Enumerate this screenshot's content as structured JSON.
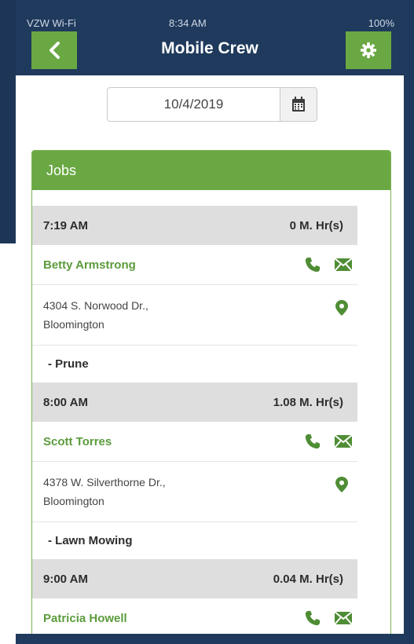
{
  "statusbar": {
    "carrier": "VZW Wi-Fi",
    "time": "8:34 AM",
    "battery": "100%"
  },
  "header": {
    "title": "Mobile Crew",
    "back_icon": "chevron-left-icon",
    "settings_icon": "gear-icon"
  },
  "date_picker": {
    "value": "10/4/2019",
    "icon": "calendar-icon"
  },
  "jobs_panel": {
    "title": "Jobs",
    "jobs": [
      {
        "time": "7:19 AM",
        "hours": "0 M. Hr(s)",
        "name": "Betty Armstrong",
        "address_line1": "4304 S. Norwood Dr.,",
        "address_line2": "Bloomington",
        "task": "- Prune"
      },
      {
        "time": "8:00 AM",
        "hours": "1.08 M. Hr(s)",
        "name": "Scott Torres",
        "address_line1": "4378 W. Silverthorne Dr.,",
        "address_line2": "Bloomington",
        "task": "- Lawn Mowing"
      },
      {
        "time": "9:00 AM",
        "hours": "0.04 M. Hr(s)",
        "name": "Patricia Howell"
      }
    ]
  },
  "colors": {
    "navy": "#1f3a5c",
    "green": "#6aa843",
    "green_text": "#5b9b3c",
    "row_gray": "#dedede"
  }
}
